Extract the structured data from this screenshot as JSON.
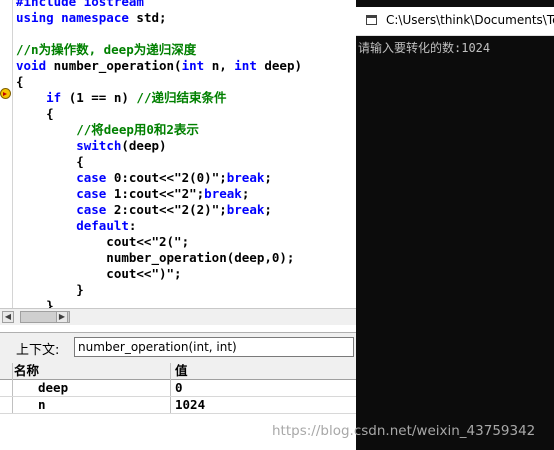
{
  "editor": {
    "lines": [
      [
        {
          "t": "#include iostream",
          "c": "kw"
        }
      ],
      [
        {
          "t": "using namespace ",
          "c": "kw"
        },
        {
          "t": "std;",
          "c": ""
        }
      ],
      [
        {
          "t": "",
          "c": ""
        }
      ],
      [
        {
          "t": "//n为操作数, deep为递归深度",
          "c": "cm"
        }
      ],
      [
        {
          "t": "void ",
          "c": "kw"
        },
        {
          "t": "number_operation(",
          "c": ""
        },
        {
          "t": "int ",
          "c": "kw"
        },
        {
          "t": "n, ",
          "c": ""
        },
        {
          "t": "int ",
          "c": "kw"
        },
        {
          "t": "deep)",
          "c": ""
        }
      ],
      [
        {
          "t": "{",
          "c": ""
        }
      ],
      [
        {
          "t": "    ",
          "c": ""
        },
        {
          "t": "if ",
          "c": "kw"
        },
        {
          "t": "(1 == n) ",
          "c": ""
        },
        {
          "t": "//递归结束条件",
          "c": "cm"
        }
      ],
      [
        {
          "t": "    {",
          "c": ""
        }
      ],
      [
        {
          "t": "        ",
          "c": ""
        },
        {
          "t": "//将deep用0和2表示",
          "c": "cm"
        }
      ],
      [
        {
          "t": "        ",
          "c": ""
        },
        {
          "t": "switch",
          "c": "kw"
        },
        {
          "t": "(deep)",
          "c": ""
        }
      ],
      [
        {
          "t": "        {",
          "c": ""
        }
      ],
      [
        {
          "t": "        ",
          "c": ""
        },
        {
          "t": "case ",
          "c": "kw"
        },
        {
          "t": "0:cout<<\"2(0)\";",
          "c": ""
        },
        {
          "t": "break",
          "c": "kw"
        },
        {
          "t": ";",
          "c": ""
        }
      ],
      [
        {
          "t": "        ",
          "c": ""
        },
        {
          "t": "case ",
          "c": "kw"
        },
        {
          "t": "1:cout<<\"2\";",
          "c": ""
        },
        {
          "t": "break",
          "c": "kw"
        },
        {
          "t": ";",
          "c": ""
        }
      ],
      [
        {
          "t": "        ",
          "c": ""
        },
        {
          "t": "case ",
          "c": "kw"
        },
        {
          "t": "2:cout<<\"2(2)\";",
          "c": ""
        },
        {
          "t": "break",
          "c": "kw"
        },
        {
          "t": ";",
          "c": ""
        }
      ],
      [
        {
          "t": "        ",
          "c": ""
        },
        {
          "t": "default",
          "c": "kw"
        },
        {
          "t": ":",
          "c": ""
        }
      ],
      [
        {
          "t": "            cout<<\"2(\";",
          "c": ""
        }
      ],
      [
        {
          "t": "            number_operation(deep,0);",
          "c": ""
        }
      ],
      [
        {
          "t": "            cout<<\")\";",
          "c": ""
        }
      ],
      [
        {
          "t": "        }",
          "c": ""
        }
      ],
      [
        {
          "t": "    }",
          "c": ""
        }
      ]
    ]
  },
  "context": {
    "label": "上下文:",
    "value": "number_operation(int, int)"
  },
  "variables": {
    "columns": [
      "名称",
      "值"
    ],
    "rows": [
      {
        "name": "deep",
        "value": "0"
      },
      {
        "name": "n",
        "value": "1024"
      }
    ]
  },
  "console": {
    "title": "C:\\Users\\think\\Documents\\Te",
    "output": "请输入要转化的数:1024"
  },
  "watermark": "https://blog.csdn.net/weixin_43759342"
}
